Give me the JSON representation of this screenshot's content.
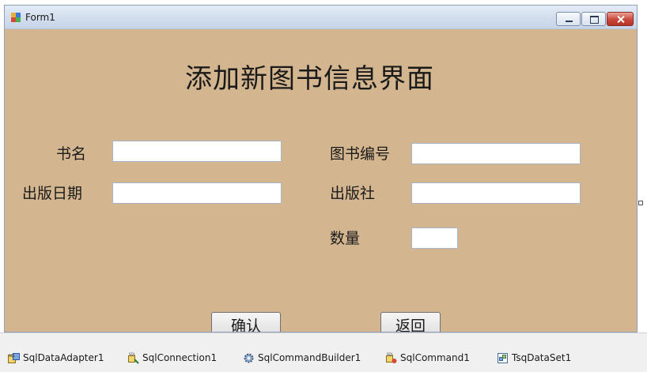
{
  "window": {
    "title": "Form1",
    "icon": "form-icon",
    "controls": [
      "minimize-icon",
      "maximize-icon",
      "close-icon"
    ]
  },
  "form": {
    "heading": "添加新图书信息界面",
    "labels": {
      "book_name": "书名",
      "book_id": "图书编号",
      "publish_date": "出版日期",
      "publisher": "出版社",
      "quantity": "数量"
    },
    "fields": {
      "book_name": "",
      "book_id": "",
      "publish_date": "",
      "publisher": "",
      "quantity": ""
    },
    "buttons": {
      "confirm": "确认",
      "back": "返回"
    }
  },
  "tray": {
    "items": [
      {
        "label": "SqlDataAdapter1",
        "icon": "sql-data-adapter-icon"
      },
      {
        "label": "SqlConnection1",
        "icon": "sql-connection-icon"
      },
      {
        "label": "SqlCommandBuilder1",
        "icon": "gear-icon"
      },
      {
        "label": "SqlCommand1",
        "icon": "sql-command-icon"
      },
      {
        "label": "TsqDataSet1",
        "icon": "dataset-icon"
      }
    ]
  },
  "colors": {
    "form_background": "#d3b68f",
    "title_bar": "#d3deee",
    "close_button": "#c9463a"
  }
}
